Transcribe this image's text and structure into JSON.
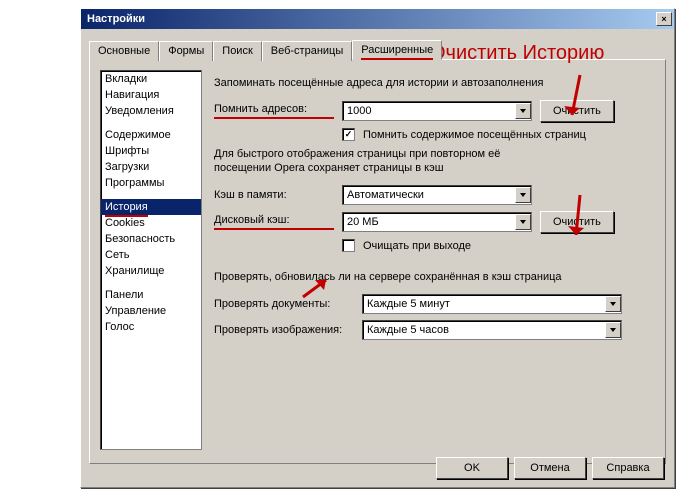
{
  "window": {
    "title": "Настройки"
  },
  "tabs": {
    "osnovnye": "Основные",
    "formy": "Формы",
    "poisk": "Поиск",
    "veb": "Веб-страницы",
    "rasshirennye": "Расширенные"
  },
  "sidebar": {
    "group1": [
      "Вкладки",
      "Навигация",
      "Уведомления"
    ],
    "group2": [
      "Содержимое",
      "Шрифты",
      "Загрузки",
      "Программы"
    ],
    "group3": [
      "История",
      "Cookies",
      "Безопасность",
      "Сеть",
      "Хранилище"
    ],
    "group4": [
      "Панели",
      "Управление",
      "Голос"
    ],
    "selected": "История"
  },
  "content": {
    "remember_addresses_desc": "Запоминать посещённые адреса для истории и автозаполнения",
    "remember_label": "Помнить адресов:",
    "remember_value": "1000",
    "clear_button": "Очистить",
    "remember_content_check": "Помнить содержимое посещённых страниц",
    "cache_desc1": "Для быстрого отображения страницы при повторном её",
    "cache_desc2": "посещении Opera сохраняет страницы в кэш",
    "memory_cache_label": "Кэш в памяти:",
    "memory_cache_value": "Автоматически",
    "disk_cache_label": "Дисковый кэш:",
    "disk_cache_value": "20 МБ",
    "clear_on_exit": "Очищать при выходе",
    "check_desc": "Проверять, обновилась ли на сервере сохранённая в кэш страница",
    "check_docs_label": "Проверять документы:",
    "check_docs_value": "Каждые 5 минут",
    "check_images_label": "Проверять изображения:",
    "check_images_value": "Каждые 5 часов"
  },
  "buttons": {
    "ok": "OK",
    "cancel": "Отмена",
    "help": "Справка"
  },
  "annotation": {
    "text": "Очистить Историю"
  }
}
